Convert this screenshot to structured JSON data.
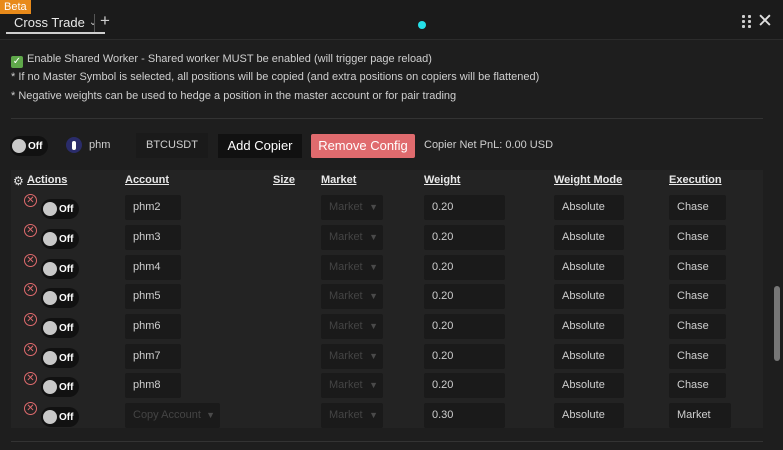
{
  "badge": "Beta",
  "tab": {
    "label": "Cross Trade",
    "chevron": "chevron-down-icon",
    "add": "+"
  },
  "window": {
    "close": "✕"
  },
  "info": {
    "line1": "Enable Shared Worker - Shared worker MUST be enabled (will trigger page reload)",
    "line2": "* If no Master Symbol is selected, all positions will be copied (and extra positions on copiers will be flattened)",
    "line3": "* Negative weights can be used to hedge a position in the master account or for pair trading"
  },
  "controls": {
    "toggle": "Off",
    "account": "phm",
    "symbol": "BTCUSDT",
    "add_copier": "Add Copier",
    "remove_config": "Remove Config",
    "pnl": "Copier Net PnL: 0.00 USD"
  },
  "table": {
    "headers": {
      "actions": "Actions",
      "account": "Account",
      "size": "Size",
      "market": "Market",
      "weight": "Weight",
      "weight_mode": "Weight Mode",
      "execution": "Execution"
    },
    "rows": [
      {
        "toggle": "Off",
        "account": "phm2",
        "market": "Market",
        "weight": "0.20",
        "weight_mode": "Absolute",
        "execution": "Chase"
      },
      {
        "toggle": "Off",
        "account": "phm3",
        "market": "Market",
        "weight": "0.20",
        "weight_mode": "Absolute",
        "execution": "Chase"
      },
      {
        "toggle": "Off",
        "account": "phm4",
        "market": "Market",
        "weight": "0.20",
        "weight_mode": "Absolute",
        "execution": "Chase"
      },
      {
        "toggle": "Off",
        "account": "phm5",
        "market": "Market",
        "weight": "0.20",
        "weight_mode": "Absolute",
        "execution": "Chase"
      },
      {
        "toggle": "Off",
        "account": "phm6",
        "market": "Market",
        "weight": "0.20",
        "weight_mode": "Absolute",
        "execution": "Chase"
      },
      {
        "toggle": "Off",
        "account": "phm7",
        "market": "Market",
        "weight": "0.20",
        "weight_mode": "Absolute",
        "execution": "Chase"
      },
      {
        "toggle": "Off",
        "account": "phm8",
        "market": "Market",
        "weight": "0.20",
        "weight_mode": "Absolute",
        "execution": "Chase"
      },
      {
        "toggle": "Off",
        "account": "Copy Account",
        "market": "Market",
        "weight": "0.30",
        "weight_mode": "Absolute",
        "execution": "Market"
      }
    ]
  },
  "colors": {
    "accent": "#25e0e8",
    "danger": "#e06b6e",
    "beta": "#e88a1a",
    "check": "#5fa84a"
  }
}
